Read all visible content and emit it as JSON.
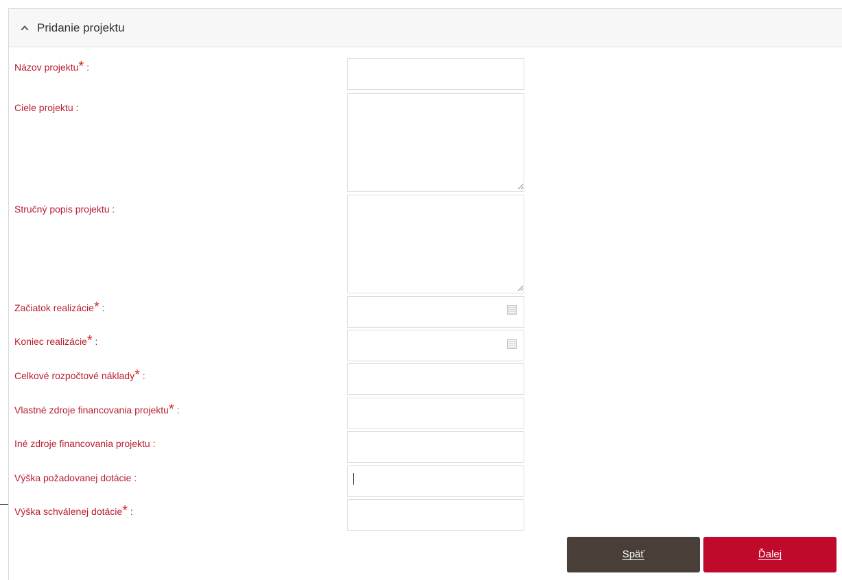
{
  "panel": {
    "title": "Pridanie projektu",
    "collapse_icon": "chevron-up-icon"
  },
  "form": {
    "nazov_label": "Názov projektu",
    "ciele_label": "Ciele projektu :",
    "popis_label": "Stručný popis projektu :",
    "zaciatok_label": "Začiatok realizácie",
    "koniec_label": "Koniec realizácie",
    "naklady_label": "Celkové rozpočtové náklady",
    "vlastne_label": "Vlastné zdroje financovania projektu",
    "ine_label": "Iné zdroje financovania projektu :",
    "pozadovana_label": "Výška požadovanej dotácie :",
    "schvalena_label": "Výška schválenej dotácie",
    "required_mark": "*",
    "suffix": " :",
    "calendar_icon": "calendar-icon"
  },
  "buttons": {
    "back": "Späť",
    "next": "Ďalej"
  },
  "colors": {
    "label": "#b81c2e",
    "required": "#e2231a",
    "back_button": "#4a3f38",
    "next_button": "#bf0a2c"
  }
}
